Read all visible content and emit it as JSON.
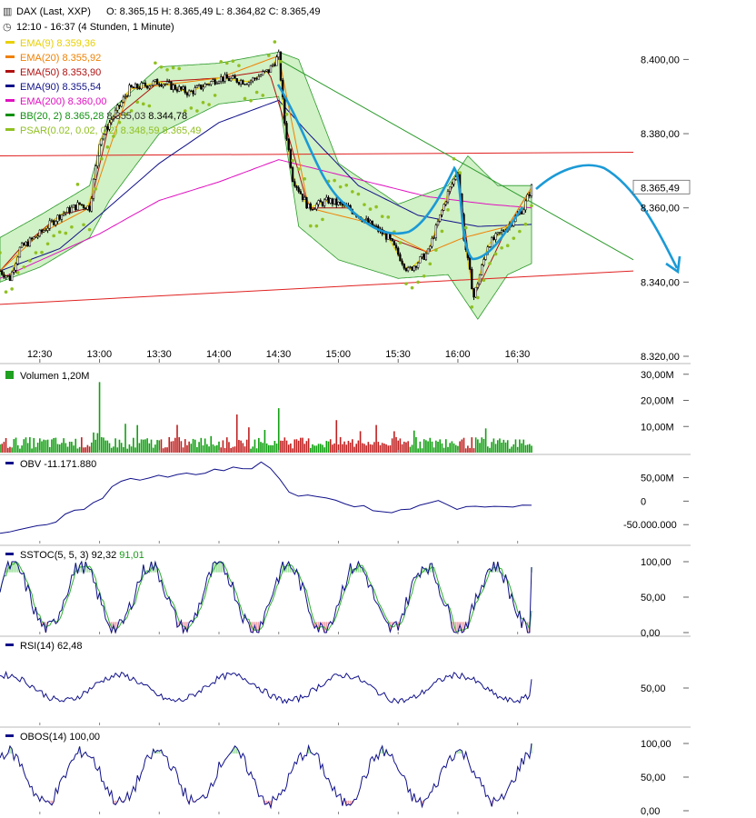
{
  "header": {
    "title": "DAX (Last, XXP)",
    "ohlc": "O: 8.365,15  H: 8.365,49  L: 8.364,82  C: 8.365,49",
    "period": "12:10 - 16:37 (4 Stunden, 1 Minute)"
  },
  "legend": [
    {
      "label": "EMA(9)",
      "value": "8.359,36",
      "color": "#e8d000"
    },
    {
      "label": "EMA(20)",
      "value": "8.355,92",
      "color": "#f08000"
    },
    {
      "label": "EMA(50)",
      "value": "8.353,90",
      "color": "#b01010"
    },
    {
      "label": "EMA(90)",
      "value": "8.355,54",
      "color": "#10108a"
    },
    {
      "label": "EMA(200)",
      "value": "8.360,00",
      "color": "#e010c0"
    },
    {
      "label": "BB(20, 2)",
      "value": "8.365,28",
      "value2": "8.355,03",
      "value3": "8.344,78",
      "color": "#109010"
    },
    {
      "label": "PSAR(0.02, 0.02, 0.2)",
      "value": "8.348,59",
      "value2": "8.365,49",
      "color": "#90c020"
    }
  ],
  "last_price_label": "8.365,49",
  "colors": {
    "up": "#10a010",
    "down": "#c02020",
    "bb_fill": "#ccf0c0",
    "projection": "#1b9ad6",
    "trend_red": "#e02020",
    "trend_green": "#2a9a2a",
    "osc_line": "#10108a",
    "osc_signal": "#30b030"
  },
  "chart_data": [
    {
      "type": "candlestick",
      "title": "DAX (Last, XXP)",
      "x_tick_labels": [
        "12:30",
        "13:00",
        "13:30",
        "14:00",
        "14:30",
        "15:00",
        "15:30",
        "16:00",
        "16:30"
      ],
      "y_tick_labels": [
        "8.400,00",
        "8.380,00",
        "8.360,00",
        "8.340,00",
        "8.320,00"
      ],
      "ylim": [
        8320,
        8405
      ],
      "grid": false,
      "x_start": "12:10",
      "x_end": "16:37",
      "close_path": [
        [
          "12:10",
          8343
        ],
        [
          "12:15",
          8341
        ],
        [
          "12:20",
          8349
        ],
        [
          "12:30",
          8353
        ],
        [
          "12:40",
          8358
        ],
        [
          "12:50",
          8361
        ],
        [
          "12:55",
          8360
        ],
        [
          "13:00",
          8378
        ],
        [
          "13:05",
          8383
        ],
        [
          "13:15",
          8392
        ],
        [
          "13:30",
          8394
        ],
        [
          "13:45",
          8391
        ],
        [
          "14:00",
          8395
        ],
        [
          "14:15",
          8394
        ],
        [
          "14:25",
          8397
        ],
        [
          "14:30",
          8401
        ],
        [
          "14:33",
          8383
        ],
        [
          "14:37",
          8368
        ],
        [
          "14:45",
          8360
        ],
        [
          "14:55",
          8362
        ],
        [
          "15:05",
          8360
        ],
        [
          "15:15",
          8356
        ],
        [
          "15:25",
          8352
        ],
        [
          "15:35",
          8343
        ],
        [
          "15:45",
          8348
        ],
        [
          "15:55",
          8364
        ],
        [
          "16:00",
          8370
        ],
        [
          "16:03",
          8352
        ],
        [
          "16:08",
          8336
        ],
        [
          "16:15",
          8350
        ],
        [
          "16:25",
          8355
        ],
        [
          "16:33",
          8360
        ],
        [
          "16:37",
          8365.49
        ]
      ],
      "bb_upper": [
        [
          "12:10",
          8352
        ],
        [
          "12:30",
          8358
        ],
        [
          "12:55",
          8366
        ],
        [
          "13:05",
          8386
        ],
        [
          "13:30",
          8398
        ],
        [
          "14:00",
          8399
        ],
        [
          "14:30",
          8402
        ],
        [
          "14:40",
          8400
        ],
        [
          "15:00",
          8372
        ],
        [
          "15:30",
          8361
        ],
        [
          "15:55",
          8366
        ],
        [
          "16:05",
          8374
        ],
        [
          "16:20",
          8366
        ],
        [
          "16:37",
          8366
        ]
      ],
      "bb_lower": [
        [
          "12:10",
          8340
        ],
        [
          "12:30",
          8344
        ],
        [
          "12:55",
          8352
        ],
        [
          "13:05",
          8362
        ],
        [
          "13:30",
          8380
        ],
        [
          "14:00",
          8388
        ],
        [
          "14:30",
          8390
        ],
        [
          "14:40",
          8355
        ],
        [
          "15:00",
          8346
        ],
        [
          "15:30",
          8341
        ],
        [
          "15:55",
          8342
        ],
        [
          "16:10",
          8330
        ],
        [
          "16:25",
          8342
        ],
        [
          "16:37",
          8345
        ]
      ],
      "ema90": [
        [
          "12:10",
          8343
        ],
        [
          "12:40",
          8349
        ],
        [
          "13:00",
          8358
        ],
        [
          "13:30",
          8372
        ],
        [
          "14:00",
          8383
        ],
        [
          "14:30",
          8389
        ],
        [
          "14:45",
          8380
        ],
        [
          "15:10",
          8366
        ],
        [
          "15:40",
          8358
        ],
        [
          "16:10",
          8355
        ],
        [
          "16:37",
          8355.54
        ]
      ],
      "ema200": [
        [
          "12:10",
          8341
        ],
        [
          "13:00",
          8353
        ],
        [
          "13:30",
          8362
        ],
        [
          "14:00",
          8367
        ],
        [
          "14:30",
          8373
        ],
        [
          "14:45",
          8371
        ],
        [
          "15:15",
          8367
        ],
        [
          "15:45",
          8363
        ],
        [
          "16:15",
          8361
        ],
        [
          "16:37",
          8360
        ]
      ],
      "trend_lines": [
        {
          "color": "red",
          "from": [
            "12:10",
            8374
          ],
          "to": [
            "16:37",
            8375
          ]
        },
        {
          "color": "red",
          "from": [
            "12:10",
            8334
          ],
          "to": [
            "16:37",
            8343
          ]
        },
        {
          "color": "green",
          "from": [
            "14:30",
            8400
          ],
          "to": [
            "16:37",
            8346
          ]
        }
      ]
    },
    {
      "type": "bar",
      "title": "Volumen",
      "value_label": "1,20M",
      "y_tick_labels": [
        "30,00M",
        "20,00M",
        "10,00M"
      ],
      "ylim": [
        0,
        32000000
      ]
    },
    {
      "type": "line",
      "title": "OBV",
      "value_label": "-11.171.880",
      "y_tick_labels": [
        "50,00M",
        "0",
        "-50.000.000"
      ],
      "ylim": [
        -65000000,
        80000000
      ],
      "values": [
        -70,
        -66,
        -60,
        -58,
        -55,
        -50,
        -42,
        -30,
        -22,
        -16,
        -5,
        8,
        30,
        45,
        48,
        44,
        52,
        55,
        50,
        58,
        60,
        58,
        62,
        66,
        64,
        70,
        72,
        70,
        85,
        70,
        45,
        20,
        10,
        14,
        8,
        5,
        2,
        -8,
        -12,
        -10,
        -18,
        -20,
        -22,
        -20,
        -14,
        -8,
        -4,
        0,
        -10,
        -18,
        -12,
        -8,
        -12,
        -14,
        -10,
        -12,
        -8,
        -11
      ]
    },
    {
      "type": "line",
      "title": "SSTOC(5, 5, 3)",
      "value_label": "92,32",
      "value_label2": "91,01",
      "y_tick_labels": [
        "100,00",
        "50,00",
        "0,00"
      ],
      "ylim": [
        0,
        100
      ]
    },
    {
      "type": "line",
      "title": "RSI(14)",
      "value_label": "62,48",
      "y_tick_labels": [
        "50,00"
      ],
      "ylim": [
        0,
        100
      ]
    },
    {
      "type": "line",
      "title": "OBOS(14)",
      "value_label": "100,00",
      "y_tick_labels": [
        "100,00",
        "50,00",
        "0,00"
      ],
      "ylim": [
        0,
        100
      ]
    }
  ]
}
